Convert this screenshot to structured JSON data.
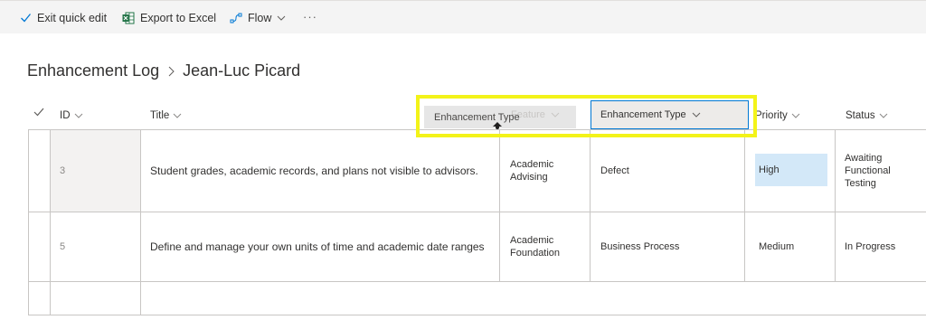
{
  "toolbar": {
    "exit_quick_edit": "Exit quick edit",
    "export_to_excel": "Export to Excel",
    "flow": "Flow",
    "more": "···"
  },
  "breadcrumb": {
    "list": "Enhancement Log",
    "view": "Jean-Luc Picard"
  },
  "columns": {
    "id": "ID",
    "title": "Title",
    "feature": "Feature",
    "enhancement_type": "Enhancement Type",
    "priority": "Priority",
    "status": "Status"
  },
  "drag": {
    "ghost_label": "Enhancement Type",
    "faded_label": "Feature"
  },
  "rows": [
    {
      "id": "3",
      "title": "Student grades, academic records, and plans not visible to advisors.",
      "feature": "Academic Advising",
      "enhancement_type": "Defect",
      "priority": "High",
      "status": "Awaiting Functional Testing"
    },
    {
      "id": "5",
      "title": "Define and manage your own units of time and academic date ranges",
      "feature": "Academic Foundation",
      "enhancement_type": "Business Process",
      "priority": "Medium",
      "status": "In Progress"
    }
  ],
  "colors": {
    "accent": "#0078d4",
    "highlight": "#f3f319",
    "selected_cell": "#d3e8f8",
    "excel_green": "#217346"
  },
  "icons": [
    "checkmark-icon",
    "excel-icon",
    "flow-icon",
    "chevron-down-icon",
    "chevron-right-icon"
  ]
}
